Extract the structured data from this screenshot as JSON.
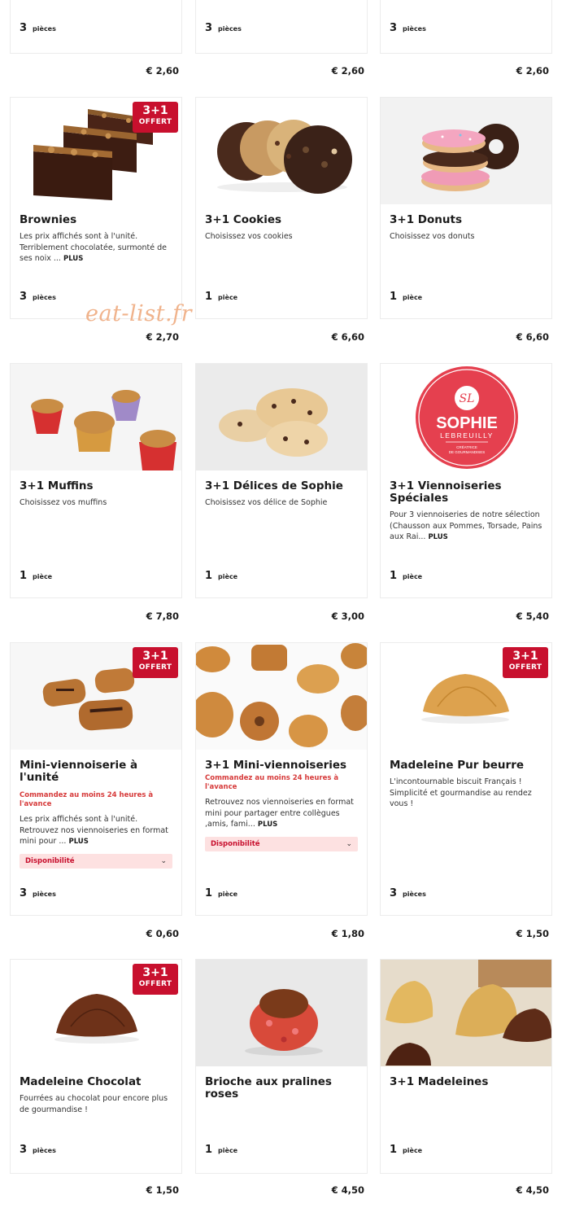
{
  "watermark": "eat-list.fr",
  "badge": {
    "line1": "3+1",
    "line2": "OFFERT"
  },
  "top_row": [
    {
      "qty": "3",
      "unit": "pièces",
      "price": "€ 2,60"
    },
    {
      "qty": "3",
      "unit": "pièces",
      "price": "€ 2,60"
    },
    {
      "qty": "3",
      "unit": "pièces",
      "price": "€ 2,60"
    }
  ],
  "products": [
    {
      "title": "Brownies",
      "desc": "Les prix affichés sont à l'unité. Terriblement chocolatée, surmonté de ses noix ...",
      "more": "PLUS",
      "qty": "3",
      "unit": "pièces",
      "price": "€ 2,70",
      "image": "brownies",
      "badge": true
    },
    {
      "title": "3+1 Cookies",
      "desc": "Choisissez vos cookies",
      "qty": "1",
      "unit": "pièce",
      "price": "€ 6,60",
      "image": "cookies"
    },
    {
      "title": "3+1 Donuts",
      "desc": "Choisissez vos donuts",
      "qty": "1",
      "unit": "pièce",
      "price": "€ 6,60",
      "image": "donuts"
    },
    {
      "title": "3+1 Muffins",
      "desc": "Choisissez vos muffins",
      "qty": "1",
      "unit": "pièce",
      "price": "€ 7,80",
      "image": "muffins"
    },
    {
      "title": "3+1 Délices de Sophie",
      "desc": "Choisissez vos délice de Sophie",
      "qty": "1",
      "unit": "pièce",
      "price": "€ 3,00",
      "image": "delices"
    },
    {
      "title": "3+1 Viennoiseries Spéciales",
      "desc": "Pour 3 viennoiseries de notre sélection (Chausson aux Pommes, Torsade, Pains aux Rai...",
      "more": "PLUS",
      "qty": "1",
      "unit": "pièce",
      "price": "€ 5,40",
      "image": "sophie-logo",
      "logo": {
        "name": "SOPHIE",
        "sub": "LEBREUILLY",
        "tag": "CRÉATRICE",
        "tag2": "DE GOURMANDISES",
        "color": "#e5404f"
      }
    },
    {
      "title": "Mini-viennoiserie à l'unité",
      "note": "Commandez au moins 24 heures à l'avance",
      "desc": "Les prix affichés sont à l'unité. Retrouvez nos viennoiseries en format mini pour ...",
      "more": "PLUS",
      "select": "Disponibilité",
      "qty": "3",
      "unit": "pièces",
      "price": "€ 0,60",
      "image": "mini-viennoiserie",
      "badge": true
    },
    {
      "title": "3+1 Mini-viennoiseries",
      "note": "Commandez au moins 24 heures à l'avance",
      "desc": "Retrouvez nos viennoiseries en format mini pour partager entre collègues ,amis, fami...",
      "more": "PLUS",
      "select": "Disponibilité",
      "qty": "1",
      "unit": "pièce",
      "price": "€ 1,80",
      "image": "viennoiseries-spread"
    },
    {
      "title": "Madeleine Pur beurre",
      "desc": "L'incontournable biscuit Français ! Simplicité et gourmandise au rendez vous !",
      "qty": "3",
      "unit": "pièces",
      "price": "€ 1,50",
      "image": "madeleine",
      "badge": true
    },
    {
      "title": "Madeleine Chocolat",
      "desc": "Fourrées au chocolat pour encore plus de gourmandise !",
      "qty": "3",
      "unit": "pièces",
      "price": "€ 1,50",
      "image": "madeleine-chocolat",
      "badge": true
    },
    {
      "title": "Brioche aux pralines roses",
      "desc": "",
      "qty": "1",
      "unit": "pièce",
      "price": "€ 4,50",
      "image": "brioche"
    },
    {
      "title": "3+1 Madeleines",
      "desc": "",
      "qty": "1",
      "unit": "pièce",
      "price": "€ 4,50",
      "image": "madeleines"
    }
  ],
  "colors": {
    "accent": "#c8102e",
    "note": "#d63a3a",
    "select_bg": "#fde1e1",
    "watermark": "#f0b38c"
  }
}
